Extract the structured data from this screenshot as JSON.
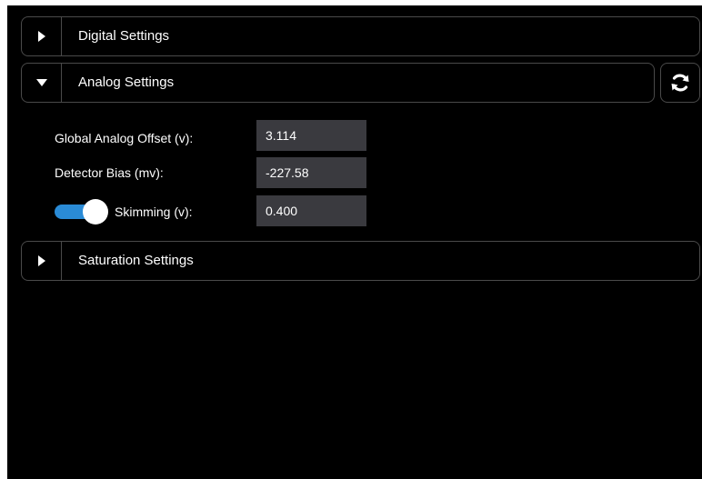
{
  "sections": {
    "digital": {
      "label": "Digital Settings",
      "expanded": false,
      "icon": "caret-right-icon"
    },
    "analog": {
      "label": "Analog Settings",
      "expanded": true,
      "icon": "caret-down-icon"
    },
    "saturation": {
      "label": "Saturation Settings",
      "expanded": false,
      "icon": "caret-right-icon"
    }
  },
  "refresh": {
    "icon": "refresh-icon"
  },
  "analog_fields": {
    "global_offset": {
      "label": "Global Analog Offset (v):",
      "value": "3.114"
    },
    "detector_bias": {
      "label": "Detector Bias (mv):",
      "value": "-227.58"
    },
    "skimming": {
      "label": "Skimming (v):",
      "value": "0.400",
      "enabled": true
    }
  },
  "colors": {
    "background": "#000000",
    "border": "#4a4a4a",
    "input_bg": "#3a3a3f",
    "switch_on": "#2a8bd6"
  }
}
